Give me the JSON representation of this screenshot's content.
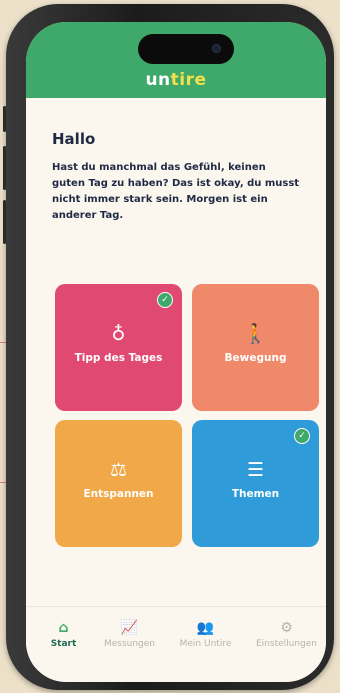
{
  "app": {
    "logo_part1": "un",
    "logo_part2": "tire"
  },
  "home": {
    "greeting": "Hallo",
    "intro": "Hast du manchmal das Gefühl, keinen guten Tag zu haben? Das ist okay, du musst nicht immer stark sein. Morgen ist ein anderer Tag."
  },
  "tiles": [
    {
      "label": "Tipp des Tages",
      "icon": "lightbulb-icon",
      "glyph": "♁",
      "color": "#e04a72",
      "completed": true
    },
    {
      "label": "Bewegung",
      "icon": "walking-icon",
      "glyph": "🚶",
      "color": "#f0886a",
      "completed": false
    },
    {
      "label": "Entspannen",
      "icon": "balance-scale-icon",
      "glyph": "⚖",
      "color": "#f0a848",
      "completed": false
    },
    {
      "label": "Themen",
      "icon": "list-icon",
      "glyph": "☰",
      "color": "#2f9bd8",
      "completed": true
    }
  ],
  "check_glyph": "✓",
  "tabbar": {
    "items": [
      {
        "label": "Start",
        "icon": "home-icon",
        "glyph": "⌂",
        "active": true
      },
      {
        "label": "Messungen",
        "icon": "chart-icon",
        "glyph": "📈",
        "active": false
      },
      {
        "label": "Mein Untire",
        "icon": "users-icon",
        "glyph": "👥",
        "active": false
      },
      {
        "label": "Einstellungen",
        "icon": "gear-icon",
        "glyph": "⚙",
        "active": false
      }
    ]
  },
  "colors": {
    "header": "#3ea96a",
    "text": "#1f2a44",
    "logo_accent": "#f3e04a",
    "tab_active": "#1f6a57",
    "tab_inactive": "#b9b3aa"
  }
}
